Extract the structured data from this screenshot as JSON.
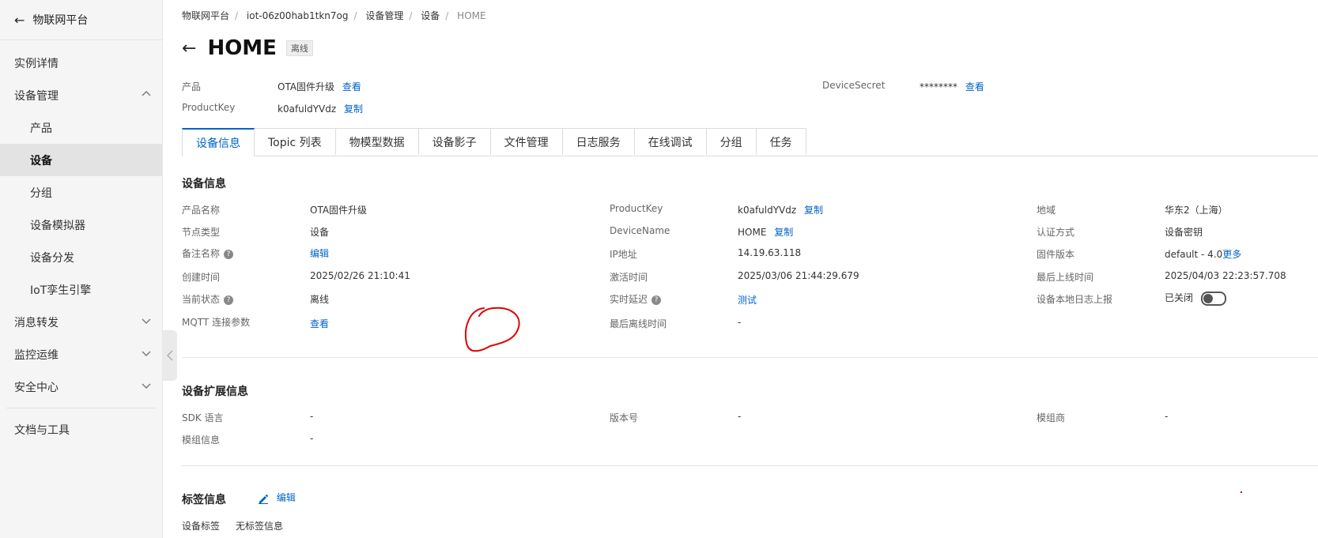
{
  "sidebar": {
    "header": "物联网平台",
    "items": [
      {
        "label": "实例详情"
      },
      {
        "label": "设备管理"
      },
      {
        "label": "产品"
      },
      {
        "label": "设备"
      },
      {
        "label": "分组"
      },
      {
        "label": "设备模拟器"
      },
      {
        "label": "设备分发"
      },
      {
        "label": "IoT孪生引擎"
      },
      {
        "label": "消息转发"
      },
      {
        "label": "监控运维"
      },
      {
        "label": "安全中心"
      },
      {
        "label": "文档与工具"
      }
    ]
  },
  "breadcrumb": [
    "物联网平台",
    "iot-06z00hab1tkn7og",
    "设备管理",
    "设备",
    "HOME"
  ],
  "page": {
    "title": "HOME",
    "status_badge": "离线"
  },
  "summary": {
    "product_label": "产品",
    "product_value": "OTA固件升级",
    "product_link": "查看",
    "productkey_label": "ProductKey",
    "productkey_value": "k0afuldYVdz",
    "copy_link": "复制",
    "secret_label": "DeviceSecret",
    "secret_value": "********",
    "secret_link": "查看"
  },
  "tabs": [
    "设备信息",
    "Topic 列表",
    "物模型数据",
    "设备影子",
    "文件管理",
    "日志服务",
    "在线调试",
    "分组",
    "任务"
  ],
  "device_info": {
    "title": "设备信息",
    "col1": [
      {
        "label": "产品名称",
        "value": "OTA固件升级"
      },
      {
        "label": "节点类型",
        "value": "设备"
      },
      {
        "label": "备注名称",
        "value": "编辑"
      },
      {
        "label": "创建时间",
        "value": "2025/02/26 21:10:41"
      },
      {
        "label": "当前状态",
        "value": "离线"
      },
      {
        "label": "MQTT 连接参数",
        "value": "查看"
      }
    ],
    "col2": [
      {
        "label": "ProductKey",
        "value": "k0afuldYVdz",
        "link": "复制"
      },
      {
        "label": "DeviceName",
        "value": "HOME",
        "link": "复制"
      },
      {
        "label": "IP地址",
        "value": "14.19.63.118"
      },
      {
        "label": "激活时间",
        "value": "2025/03/06 21:44:29.679"
      },
      {
        "label": "实时延迟",
        "value": "测试"
      },
      {
        "label": "最后离线时间",
        "value": "-"
      }
    ],
    "col3": [
      {
        "label": "地域",
        "value": "华东2（上海）"
      },
      {
        "label": "认证方式",
        "value": "设备密钥"
      },
      {
        "label": "固件版本",
        "value": "default - 4.0",
        "link": "更多"
      },
      {
        "label": "最后上线时间",
        "value": "2025/04/03 22:23:57.708"
      },
      {
        "label": "设备本地日志上报",
        "value": "已关闭"
      }
    ]
  },
  "ext_info": {
    "title": "设备扩展信息",
    "rows": [
      {
        "label": "SDK 语言",
        "value": "-"
      },
      {
        "label": "版本号",
        "value": "-"
      },
      {
        "label": "模组商",
        "value": "-"
      },
      {
        "label": "模组信息",
        "value": "-"
      }
    ]
  },
  "tags": {
    "title": "标签信息",
    "edit": "编辑",
    "label": "设备标签",
    "value": "无标签信息"
  },
  "colors": {
    "accent": "#0064c8",
    "annotation": "#e00000"
  }
}
